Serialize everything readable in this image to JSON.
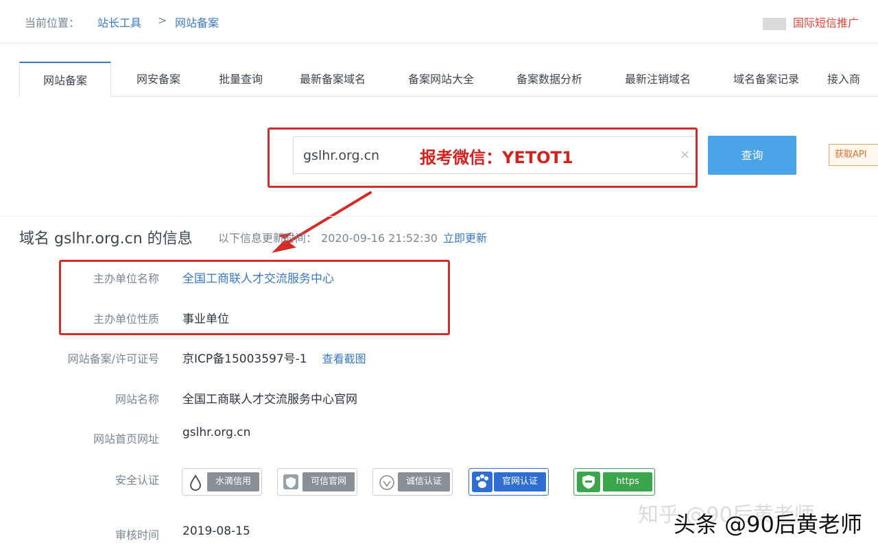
{
  "breadcrumb": {
    "prefix": "当前位置：",
    "item1": "站长工具",
    "separator": ">",
    "item2": "网站备案"
  },
  "ad": {
    "label": "国际短信推广"
  },
  "tabs": [
    {
      "label": "网站备案",
      "active": true
    },
    {
      "label": "网安备案"
    },
    {
      "label": "批量查询"
    },
    {
      "label": "最新备案域名"
    },
    {
      "label": "备案网站大全"
    },
    {
      "label": "备案数据分析"
    },
    {
      "label": "最新注销域名"
    },
    {
      "label": "域名备案记录"
    },
    {
      "label": "接入商"
    }
  ],
  "search": {
    "value": "gslhr.org.cn",
    "overlay_text": "报考微信：YETOT1",
    "clear_icon": "×",
    "button_label": "查询",
    "api_label": "获取API"
  },
  "info": {
    "title_prefix": "域名",
    "title_domain": "gslhr.org.cn",
    "title_suffix": "的信息",
    "sub_prefix": "以下信息更新时间：",
    "updated_time": "2020-09-16 21:52:30",
    "update_link": "立即更新"
  },
  "rows": {
    "org_name": {
      "label": "主办单位名称",
      "value": "全国工商联人才交流服务中心"
    },
    "org_type": {
      "label": "主办单位性质",
      "value": "事业单位"
    },
    "license": {
      "label": "网站备案/许可证号",
      "value": "京ICP备15003597号-1",
      "link": "查看截图"
    },
    "site_name": {
      "label": "网站名称",
      "value": "全国工商联人才交流服务中心官网"
    },
    "homepage": {
      "label": "网站首页网址",
      "value": "gslhr.org.cn"
    },
    "security": {
      "label": "安全认证"
    },
    "review": {
      "label": "审核时间",
      "value": "2019-08-15"
    }
  },
  "badges": [
    {
      "label": "水滴信用",
      "icon": "drop-icon",
      "color": "#8a8f97"
    },
    {
      "label": "可信官网",
      "icon": "shield-icon",
      "color": "#8a8f97"
    },
    {
      "label": "诚信认证",
      "icon": "check-icon",
      "color": "#8a8f97"
    },
    {
      "label": "官网认证",
      "icon": "paw-icon",
      "color": "#2f6fd4"
    },
    {
      "label": "https",
      "icon": "lock-icon",
      "color": "#3aa54a"
    }
  ],
  "watermark": {
    "faded": "知乎 @90后黄老师",
    "main": "头条 @90后黄老师"
  },
  "colors": {
    "accent": "#3a79c0",
    "highlight": "#d22c28",
    "button": "#4aa3e6"
  }
}
